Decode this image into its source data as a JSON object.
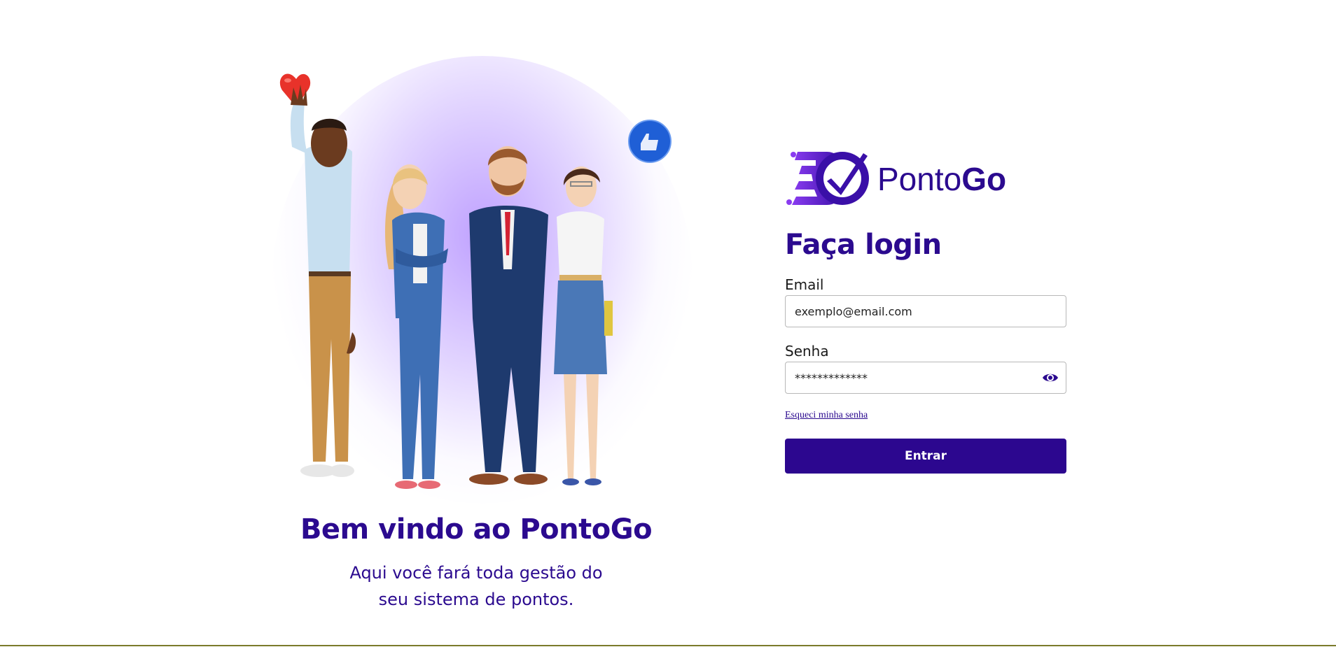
{
  "brand": {
    "name_regular": "Ponto",
    "name_bold": "Go",
    "primary_color": "#2b0a8f",
    "logo_icon": "speed-check-logo-icon"
  },
  "welcome": {
    "title": "Bem vindo ao PontoGo",
    "subtitle_line1": "Aqui você fará toda gestão do",
    "subtitle_line2": "seu sistema de pontos.",
    "illustration": "team-illustration",
    "decorations": [
      "heart-emoji-icon",
      "thumbs-up-badge-icon"
    ]
  },
  "login": {
    "title": "Faça login",
    "email_label": "Email",
    "email_placeholder": "exemplo@email.com",
    "password_label": "Senha",
    "password_value": "*************",
    "show_password_icon": "eye-icon",
    "forgot_link": "Esqueci minha senha",
    "submit_label": "Entrar",
    "button_color": "#2c078f"
  }
}
